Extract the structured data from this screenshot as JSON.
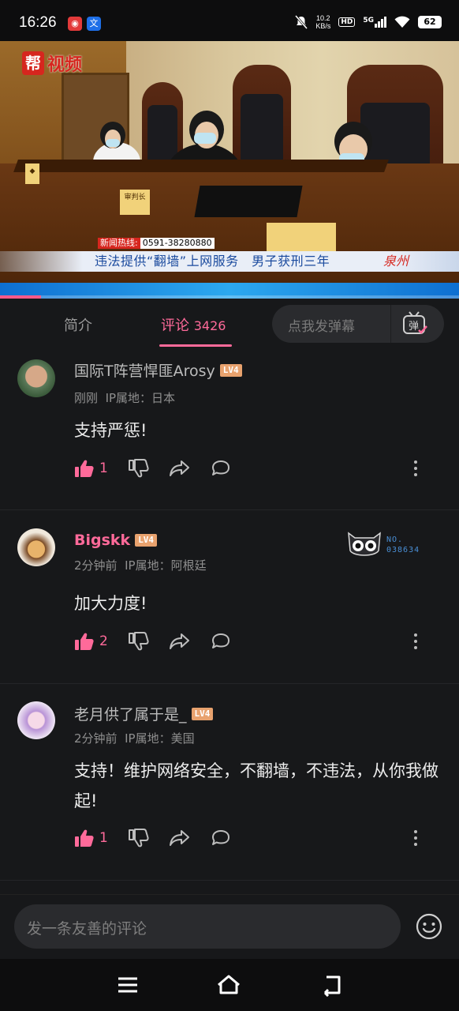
{
  "status_bar": {
    "time": "16:26",
    "app_icons": [
      "netease-icon",
      "translate-icon"
    ],
    "net_speed": "10.2",
    "net_unit": "KB/s",
    "hd": "HD",
    "signal": "5G",
    "battery": "62"
  },
  "video": {
    "logo_mark": "帮",
    "logo_text": "视频",
    "hotline_label": "新闻热线:",
    "hotline_number": "0591-38280880",
    "headline": "违法提供“翻墙”上网服务　男子获刑三年",
    "city": "泉州",
    "nameplate_center": "审判长",
    "progress": 0.09,
    "accent": "#ff5a8a"
  },
  "tabs": {
    "intro": "简介",
    "comments": "评论",
    "comments_count": "3426",
    "danmu_placeholder": "点我发弹幕",
    "danmu_icon": "弹"
  },
  "comments": [
    {
      "name": "国际T阵营悍匪Arosy",
      "level": "LV4",
      "time": "刚刚",
      "ip": "IP属地：日本",
      "text": "支持严惩!",
      "likes": "1"
    },
    {
      "name": "Bigskk",
      "level": "LV4",
      "time": "2分钟前",
      "ip": "IP属地：阿根廷",
      "text": "加大力度!",
      "likes": "2",
      "badge_label": "NO.",
      "badge_number": "038634"
    },
    {
      "name": "老月供了属于是_",
      "level": "LV4",
      "time": "2分钟前",
      "ip": "IP属地：美国",
      "text": "支持！维护网络安全，不翻墙，不违法，从你我做起!",
      "likes": "1"
    }
  ],
  "input": {
    "placeholder": "发一条友善的评论"
  },
  "colors": {
    "background": "#17181a",
    "accent": "#ff6a9a",
    "level_badge": "#e8a26e"
  }
}
